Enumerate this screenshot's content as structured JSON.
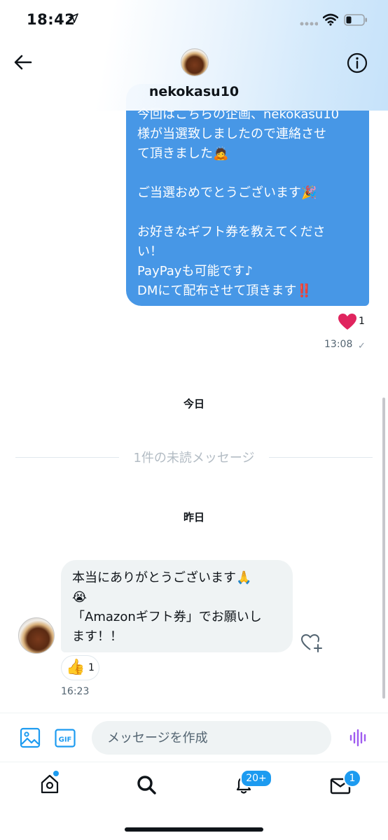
{
  "status_bar": {
    "time": "18:42"
  },
  "header": {
    "title": "nekokasu10"
  },
  "sent_message": {
    "text": "今回はこちらの企画、nekokasu10\n様が当選致しましたので連絡させ\nて頂きました🙇\n\nご当選おめでとうございます🎉\n\nお好きなギフト券を教えてくださ\nい！\nPayPayも可能です♪\nDMにて配布させて頂きます‼️",
    "reaction_count": "1",
    "time": "13:08",
    "check": "✓"
  },
  "dividers": {
    "today": "今日",
    "unread": "1件の未読メッセージ",
    "yesterday": "昨日"
  },
  "received_message": {
    "text": "本当にありがとうございます🙏\n😭\n「Amazonギフト券」でお願いし\nます！！",
    "reaction_emoji": "👍",
    "reaction_count": "1",
    "time": "16:23"
  },
  "composer": {
    "placeholder": "メッセージを作成"
  },
  "tabbar": {
    "notifications_badge": "20+",
    "messages_badge": "1"
  },
  "colors": {
    "sent_bubble": "#4797e6",
    "received_bubble": "#eff3f4",
    "accent": "#1d9bf0",
    "heart": "#e0245e"
  }
}
